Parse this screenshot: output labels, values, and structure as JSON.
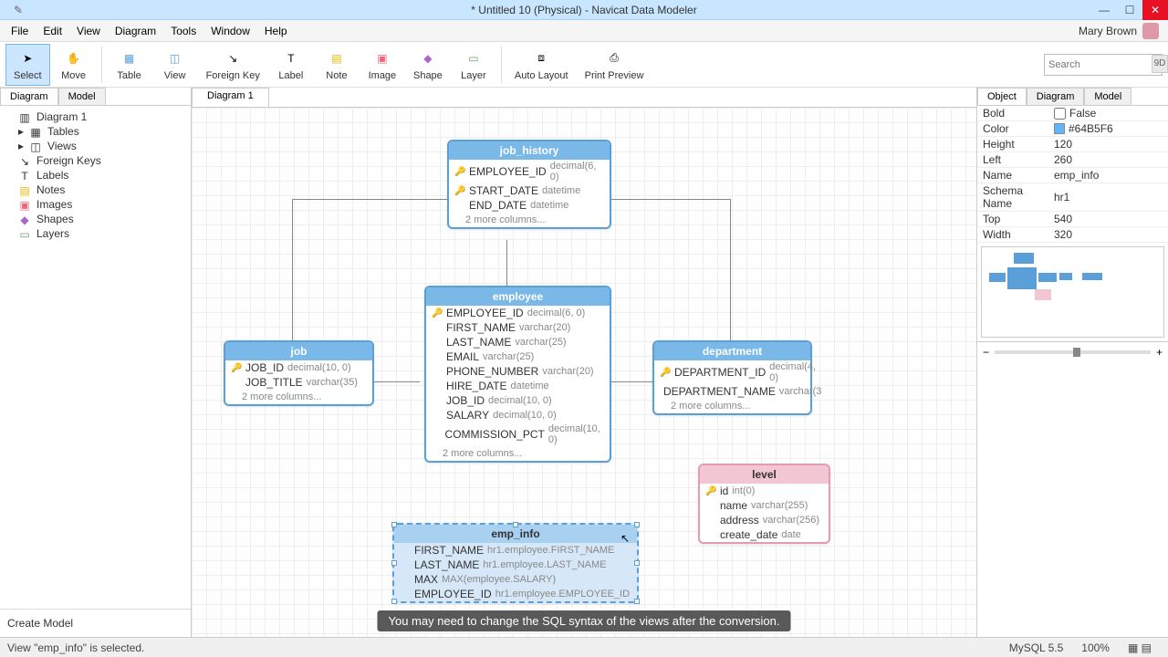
{
  "title": "* Untitled 10 (Physical) - Navicat Data Modeler",
  "menus": [
    "File",
    "Edit",
    "View",
    "Diagram",
    "Tools",
    "Window",
    "Help"
  ],
  "user": "Mary Brown",
  "tools": {
    "select": "Select",
    "move": "Move",
    "table": "Table",
    "view": "View",
    "fk": "Foreign Key",
    "label": "Label",
    "note": "Note",
    "image": "Image",
    "shape": "Shape",
    "layer": "Layer",
    "auto": "Auto Layout",
    "preview": "Print Preview"
  },
  "search_placeholder": "Search",
  "left_tabs": {
    "diagram": "Diagram",
    "model": "Model"
  },
  "tree": {
    "diagram1": "Diagram 1",
    "tables": "Tables",
    "views": "Views",
    "fks": "Foreign Keys",
    "labels": "Labels",
    "notes": "Notes",
    "images": "Images",
    "shapes": "Shapes",
    "layers": "Layers"
  },
  "create_model": "Create Model",
  "doc_tab": "Diagram 1",
  "entities": {
    "job_history": {
      "name": "job_history",
      "cols": [
        {
          "k": true,
          "n": "EMPLOYEE_ID",
          "t": "decimal(6, 0)"
        },
        {
          "k": true,
          "n": "START_DATE",
          "t": "datetime"
        },
        {
          "k": false,
          "n": "END_DATE",
          "t": "datetime"
        }
      ],
      "more": "2 more columns..."
    },
    "employee": {
      "name": "employee",
      "cols": [
        {
          "k": true,
          "n": "EMPLOYEE_ID",
          "t": "decimal(6, 0)"
        },
        {
          "k": false,
          "n": "FIRST_NAME",
          "t": "varchar(20)"
        },
        {
          "k": false,
          "n": "LAST_NAME",
          "t": "varchar(25)"
        },
        {
          "k": false,
          "n": "EMAIL",
          "t": "varchar(25)"
        },
        {
          "k": false,
          "n": "PHONE_NUMBER",
          "t": "varchar(20)"
        },
        {
          "k": false,
          "n": "HIRE_DATE",
          "t": "datetime"
        },
        {
          "k": false,
          "n": "JOB_ID",
          "t": "decimal(10, 0)"
        },
        {
          "k": false,
          "n": "SALARY",
          "t": "decimal(10, 0)"
        },
        {
          "k": false,
          "n": "COMMISSION_PCT",
          "t": "decimal(10, 0)"
        }
      ],
      "more": "2 more columns..."
    },
    "job": {
      "name": "job",
      "cols": [
        {
          "k": true,
          "n": "JOB_ID",
          "t": "decimal(10, 0)"
        },
        {
          "k": false,
          "n": "JOB_TITLE",
          "t": "varchar(35)"
        }
      ],
      "more": "2 more columns..."
    },
    "department": {
      "name": "department",
      "cols": [
        {
          "k": true,
          "n": "DEPARTMENT_ID",
          "t": "decimal(4, 0)"
        },
        {
          "k": false,
          "n": "DEPARTMENT_NAME",
          "t": "varchar(3"
        }
      ],
      "more": "2 more columns..."
    },
    "level": {
      "name": "level",
      "cols": [
        {
          "k": true,
          "n": "id",
          "t": "int(0)"
        },
        {
          "k": false,
          "n": "name",
          "t": "varchar(255)"
        },
        {
          "k": false,
          "n": "address",
          "t": "varchar(256)"
        },
        {
          "k": false,
          "n": "create_date",
          "t": "date"
        }
      ]
    },
    "emp_info": {
      "name": "emp_info",
      "cols": [
        {
          "k": false,
          "n": "FIRST_NAME",
          "t": "hr1.employee.FIRST_NAME"
        },
        {
          "k": false,
          "n": "LAST_NAME",
          "t": "hr1.employee.LAST_NAME"
        },
        {
          "k": false,
          "n": "MAX",
          "t": "MAX(employee.SALARY)"
        },
        {
          "k": false,
          "n": "EMPLOYEE_ID",
          "t": "hr1.employee.EMPLOYEE_ID"
        }
      ]
    }
  },
  "right_tabs": {
    "object": "Object",
    "diagram": "Diagram",
    "model": "Model"
  },
  "props": {
    "Bold": "False",
    "Color": "#64B5F6",
    "Height": "120",
    "Left": "260",
    "Name": "emp_info",
    "Schema Name": "hr1",
    "Top": "540",
    "Width": "320"
  },
  "caption": "You may need to change the SQL syntax of the views after the conversion.",
  "status": {
    "left": "View \"emp_info\" is selected.",
    "db": "MySQL 5.5",
    "zoom": "100%"
  },
  "extra": "9D"
}
